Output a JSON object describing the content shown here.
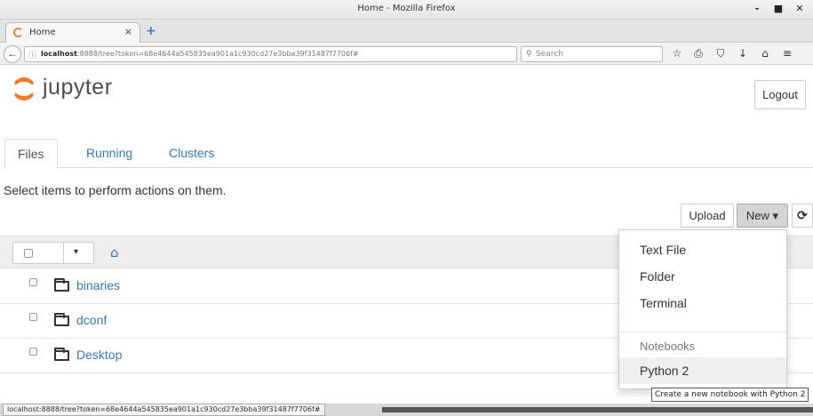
{
  "window": {
    "title": "Home - Mozilla Firefox",
    "minimize_glyph": "‑",
    "maximize_glyph": "■",
    "close_glyph": "✕"
  },
  "browser": {
    "tab_title": "Home",
    "tab_close_glyph": "×",
    "new_tab_glyph": "+",
    "back_glyph": "←",
    "info_glyph": "ⓘ",
    "url_host": "localhost",
    "url_rest": ":8888/tree?token=68e4644a545835ea901a1c930cd27e3bba39f31487f7706f#",
    "reload_glyph": "C",
    "search_placeholder": "Search",
    "search_glyph": "⚲",
    "toolbar_icons": {
      "bookmark_star": "☆",
      "bookmarks_list": "⎙",
      "pocket": "⛉",
      "downloads": "↓",
      "home": "⌂",
      "menu": "≡"
    }
  },
  "jupyter": {
    "logo_text": "jupyter",
    "logout_label": "Logout",
    "tabs": [
      {
        "label": "Files"
      },
      {
        "label": "Running"
      },
      {
        "label": "Clusters"
      }
    ],
    "instruction": "Select items to perform actions on them.",
    "buttons": {
      "upload": "Upload",
      "new": "New ▾",
      "refresh": "⟳"
    },
    "list_header": {
      "caret": "▾",
      "home_glyph": "⌂"
    },
    "files": [
      {
        "name": "binaries"
      },
      {
        "name": "dconf"
      },
      {
        "name": "Desktop"
      }
    ],
    "new_menu": {
      "items": [
        "Text File",
        "Folder",
        "Terminal"
      ],
      "section_header": "Notebooks",
      "kernels": [
        "Python 2"
      ]
    },
    "tooltip": "Create a new notebook with Python 2"
  },
  "status": {
    "url": "localhost:8888/tree?token=68e4644a545835ea901a1c930cd27e3bba39f31487f7706f#"
  }
}
